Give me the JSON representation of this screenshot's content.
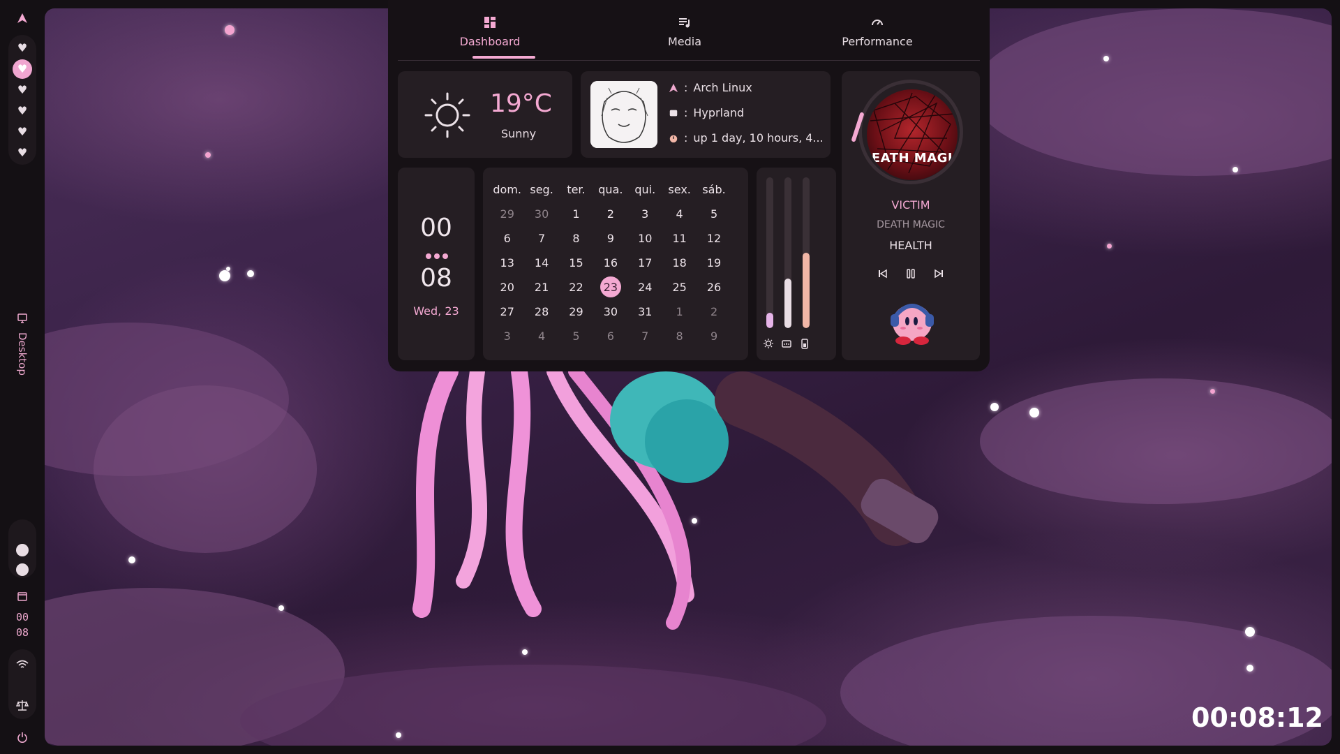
{
  "tabs": [
    {
      "label": "Dashboard",
      "icon": "dashboard-icon",
      "active": true
    },
    {
      "label": "Media",
      "icon": "music-list-icon",
      "active": false
    },
    {
      "label": "Performance",
      "icon": "gauge-icon",
      "active": false
    }
  ],
  "weather": {
    "temperature": "19°C",
    "condition": "Sunny",
    "icon": "sun-icon"
  },
  "sysinfo": {
    "distro": "Arch Linux",
    "wm": "Hyprland",
    "uptime": "up 1 day, 10 hours, 4...",
    "separator": ":"
  },
  "clock": {
    "hours": "00",
    "minutes": "08",
    "date": "Wed, 23"
  },
  "calendar": {
    "weekdays": [
      "dom.",
      "seg.",
      "ter.",
      "qua.",
      "qui.",
      "sex.",
      "sáb."
    ],
    "weeks": [
      [
        "29",
        "30",
        "1",
        "2",
        "3",
        "4",
        "5"
      ],
      [
        "6",
        "7",
        "8",
        "9",
        "10",
        "11",
        "12"
      ],
      [
        "13",
        "14",
        "15",
        "16",
        "17",
        "18",
        "19"
      ],
      [
        "20",
        "21",
        "22",
        "23",
        "24",
        "25",
        "26"
      ],
      [
        "27",
        "28",
        "29",
        "30",
        "31",
        "1",
        "2"
      ],
      [
        "3",
        "4",
        "5",
        "6",
        "7",
        "8",
        "9"
      ]
    ],
    "today": "23"
  },
  "sliders": [
    {
      "name": "brightness",
      "icon": "brightness-icon",
      "level": 0.1,
      "color": "#e6b4e8"
    },
    {
      "name": "volume",
      "icon": "speaker-icon",
      "level": 0.33,
      "color": "#e9dde4"
    },
    {
      "name": "battery",
      "icon": "battery-icon",
      "level": 0.5,
      "color": "#f2b6a7"
    }
  ],
  "media": {
    "cover_text": "EATH MAGI",
    "title": "VICTIM",
    "album": "DEATH MAGIC",
    "artist": "HEALTH",
    "controls": [
      "previous-icon",
      "pause-icon",
      "next-icon"
    ]
  },
  "leftbar": {
    "workspace_active_index": 1,
    "workspace_count": 6,
    "desktop_label": "Desktop",
    "clock_hours": "00",
    "clock_minutes": "08"
  },
  "desktop_clock": "00:08:12",
  "colors": {
    "accent": "#f4a9d2",
    "card": "#251e23",
    "panel": "#161115",
    "bar": "#141014"
  }
}
